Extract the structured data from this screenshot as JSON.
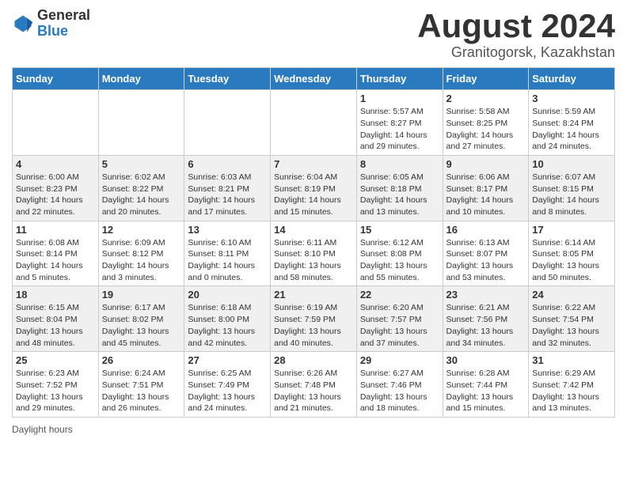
{
  "header": {
    "logo_general": "General",
    "logo_blue": "Blue",
    "main_title": "August 2024",
    "sub_title": "Granitogorsk, Kazakhstan"
  },
  "days_of_week": [
    "Sunday",
    "Monday",
    "Tuesday",
    "Wednesday",
    "Thursday",
    "Friday",
    "Saturday"
  ],
  "weeks": [
    [
      {
        "day": "",
        "info": ""
      },
      {
        "day": "",
        "info": ""
      },
      {
        "day": "",
        "info": ""
      },
      {
        "day": "",
        "info": ""
      },
      {
        "day": "1",
        "info": "Sunrise: 5:57 AM\nSunset: 8:27 PM\nDaylight: 14 hours and 29 minutes."
      },
      {
        "day": "2",
        "info": "Sunrise: 5:58 AM\nSunset: 8:25 PM\nDaylight: 14 hours and 27 minutes."
      },
      {
        "day": "3",
        "info": "Sunrise: 5:59 AM\nSunset: 8:24 PM\nDaylight: 14 hours and 24 minutes."
      }
    ],
    [
      {
        "day": "4",
        "info": "Sunrise: 6:00 AM\nSunset: 8:23 PM\nDaylight: 14 hours and 22 minutes."
      },
      {
        "day": "5",
        "info": "Sunrise: 6:02 AM\nSunset: 8:22 PM\nDaylight: 14 hours and 20 minutes."
      },
      {
        "day": "6",
        "info": "Sunrise: 6:03 AM\nSunset: 8:21 PM\nDaylight: 14 hours and 17 minutes."
      },
      {
        "day": "7",
        "info": "Sunrise: 6:04 AM\nSunset: 8:19 PM\nDaylight: 14 hours and 15 minutes."
      },
      {
        "day": "8",
        "info": "Sunrise: 6:05 AM\nSunset: 8:18 PM\nDaylight: 14 hours and 13 minutes."
      },
      {
        "day": "9",
        "info": "Sunrise: 6:06 AM\nSunset: 8:17 PM\nDaylight: 14 hours and 10 minutes."
      },
      {
        "day": "10",
        "info": "Sunrise: 6:07 AM\nSunset: 8:15 PM\nDaylight: 14 hours and 8 minutes."
      }
    ],
    [
      {
        "day": "11",
        "info": "Sunrise: 6:08 AM\nSunset: 8:14 PM\nDaylight: 14 hours and 5 minutes."
      },
      {
        "day": "12",
        "info": "Sunrise: 6:09 AM\nSunset: 8:12 PM\nDaylight: 14 hours and 3 minutes."
      },
      {
        "day": "13",
        "info": "Sunrise: 6:10 AM\nSunset: 8:11 PM\nDaylight: 14 hours and 0 minutes."
      },
      {
        "day": "14",
        "info": "Sunrise: 6:11 AM\nSunset: 8:10 PM\nDaylight: 13 hours and 58 minutes."
      },
      {
        "day": "15",
        "info": "Sunrise: 6:12 AM\nSunset: 8:08 PM\nDaylight: 13 hours and 55 minutes."
      },
      {
        "day": "16",
        "info": "Sunrise: 6:13 AM\nSunset: 8:07 PM\nDaylight: 13 hours and 53 minutes."
      },
      {
        "day": "17",
        "info": "Sunrise: 6:14 AM\nSunset: 8:05 PM\nDaylight: 13 hours and 50 minutes."
      }
    ],
    [
      {
        "day": "18",
        "info": "Sunrise: 6:15 AM\nSunset: 8:04 PM\nDaylight: 13 hours and 48 minutes."
      },
      {
        "day": "19",
        "info": "Sunrise: 6:17 AM\nSunset: 8:02 PM\nDaylight: 13 hours and 45 minutes."
      },
      {
        "day": "20",
        "info": "Sunrise: 6:18 AM\nSunset: 8:00 PM\nDaylight: 13 hours and 42 minutes."
      },
      {
        "day": "21",
        "info": "Sunrise: 6:19 AM\nSunset: 7:59 PM\nDaylight: 13 hours and 40 minutes."
      },
      {
        "day": "22",
        "info": "Sunrise: 6:20 AM\nSunset: 7:57 PM\nDaylight: 13 hours and 37 minutes."
      },
      {
        "day": "23",
        "info": "Sunrise: 6:21 AM\nSunset: 7:56 PM\nDaylight: 13 hours and 34 minutes."
      },
      {
        "day": "24",
        "info": "Sunrise: 6:22 AM\nSunset: 7:54 PM\nDaylight: 13 hours and 32 minutes."
      }
    ],
    [
      {
        "day": "25",
        "info": "Sunrise: 6:23 AM\nSunset: 7:52 PM\nDaylight: 13 hours and 29 minutes."
      },
      {
        "day": "26",
        "info": "Sunrise: 6:24 AM\nSunset: 7:51 PM\nDaylight: 13 hours and 26 minutes."
      },
      {
        "day": "27",
        "info": "Sunrise: 6:25 AM\nSunset: 7:49 PM\nDaylight: 13 hours and 24 minutes."
      },
      {
        "day": "28",
        "info": "Sunrise: 6:26 AM\nSunset: 7:48 PM\nDaylight: 13 hours and 21 minutes."
      },
      {
        "day": "29",
        "info": "Sunrise: 6:27 AM\nSunset: 7:46 PM\nDaylight: 13 hours and 18 minutes."
      },
      {
        "day": "30",
        "info": "Sunrise: 6:28 AM\nSunset: 7:44 PM\nDaylight: 13 hours and 15 minutes."
      },
      {
        "day": "31",
        "info": "Sunrise: 6:29 AM\nSunset: 7:42 PM\nDaylight: 13 hours and 13 minutes."
      }
    ]
  ],
  "footer": {
    "note": "Daylight hours"
  }
}
